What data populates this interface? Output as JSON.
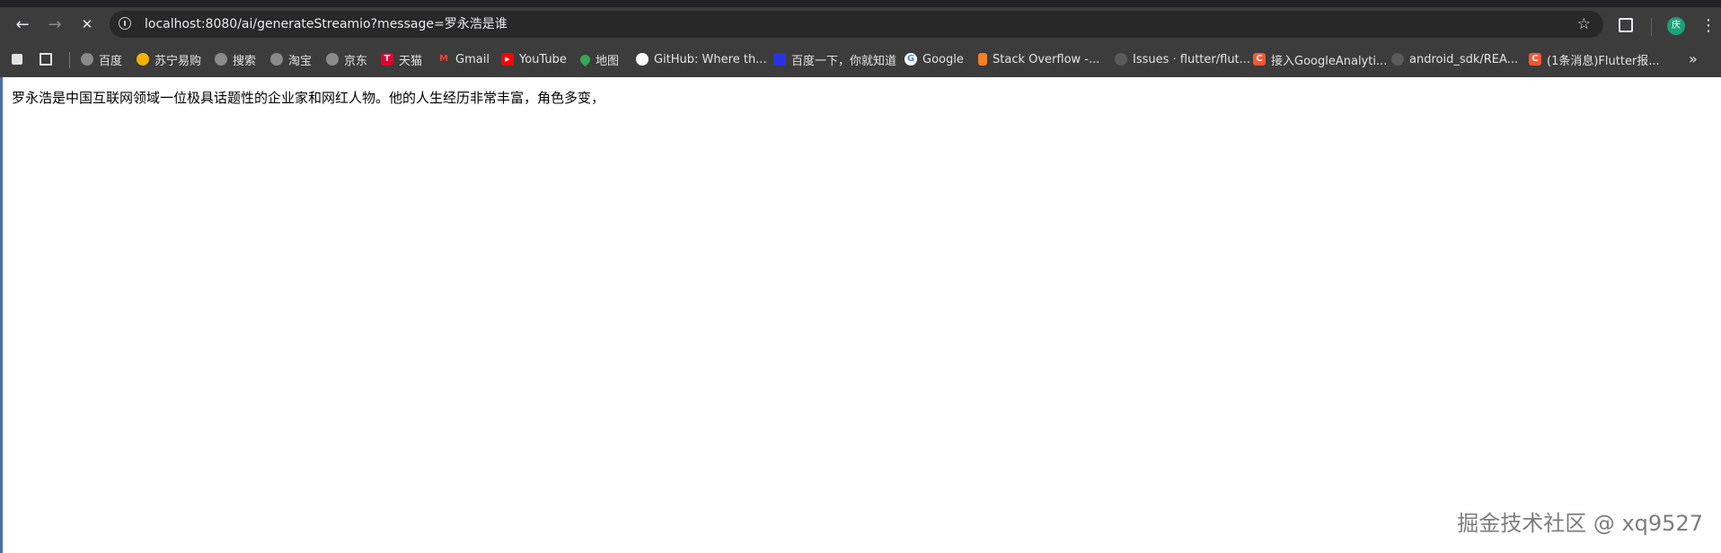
{
  "browser": {
    "address": "localhost:8080/ai/generateStreamio?message=罗永浩是谁",
    "profile_initial": "庆",
    "nav": {
      "back": "←",
      "forward": "→",
      "stop": "✕"
    },
    "star": "☆",
    "more": "»",
    "kebab": "⋮"
  },
  "bookmarks": [
    {
      "label": "百度",
      "icon": "globe-icon",
      "color": "#8a8a8a",
      "glyph": ""
    },
    {
      "label": "苏宁易购",
      "icon": "suning-icon",
      "color": "#f3b300",
      "glyph": ""
    },
    {
      "label": "搜索",
      "icon": "globe-icon",
      "color": "#8a8a8a",
      "glyph": ""
    },
    {
      "label": "淘宝",
      "icon": "globe-icon",
      "color": "#8a8a8a",
      "glyph": ""
    },
    {
      "label": "京东",
      "icon": "globe-icon",
      "color": "#8a8a8a",
      "glyph": ""
    },
    {
      "label": "天猫",
      "icon": "tmall-icon",
      "color": "#e0002d",
      "glyph": "T"
    },
    {
      "label": "Gmail",
      "icon": "gmail-icon",
      "color": "#d93025",
      "glyph": "M"
    },
    {
      "label": "YouTube",
      "icon": "youtube-icon",
      "color": "#ff0000",
      "glyph": "▶"
    },
    {
      "label": "地图",
      "icon": "maps-icon",
      "color": "#34a853",
      "glyph": ""
    },
    {
      "label": "GitHub: Where th...",
      "icon": "github-icon",
      "color": "#ffffff",
      "glyph": ""
    },
    {
      "label": "百度一下，你就知道",
      "icon": "baidu-icon",
      "color": "#2932e1",
      "glyph": ""
    },
    {
      "label": "Google",
      "icon": "google-icon",
      "color": "#4285f4",
      "glyph": "G"
    },
    {
      "label": "Stack Overflow -...",
      "icon": "stackoverflow-icon",
      "color": "#f48024",
      "glyph": ""
    },
    {
      "label": "Issues · flutter/flut...",
      "icon": "github-icon",
      "color": "#5a5a5a",
      "glyph": ""
    },
    {
      "label": "接入GoogleAnalyti...",
      "icon": "csdn-icon",
      "color": "#fc5531",
      "glyph": "C"
    },
    {
      "label": "android_sdk/REA...",
      "icon": "github-icon",
      "color": "#5a5a5a",
      "glyph": ""
    },
    {
      "label": "(1条消息)Flutter报...",
      "icon": "csdn-icon",
      "color": "#fc5531",
      "glyph": "C"
    }
  ],
  "page": {
    "text": "罗永浩是中国互联网领域一位极具话题性的企业家和网红人物。他的人生经历非常丰富，角色多变，"
  },
  "watermark": "掘金技术社区 @ xq9527"
}
